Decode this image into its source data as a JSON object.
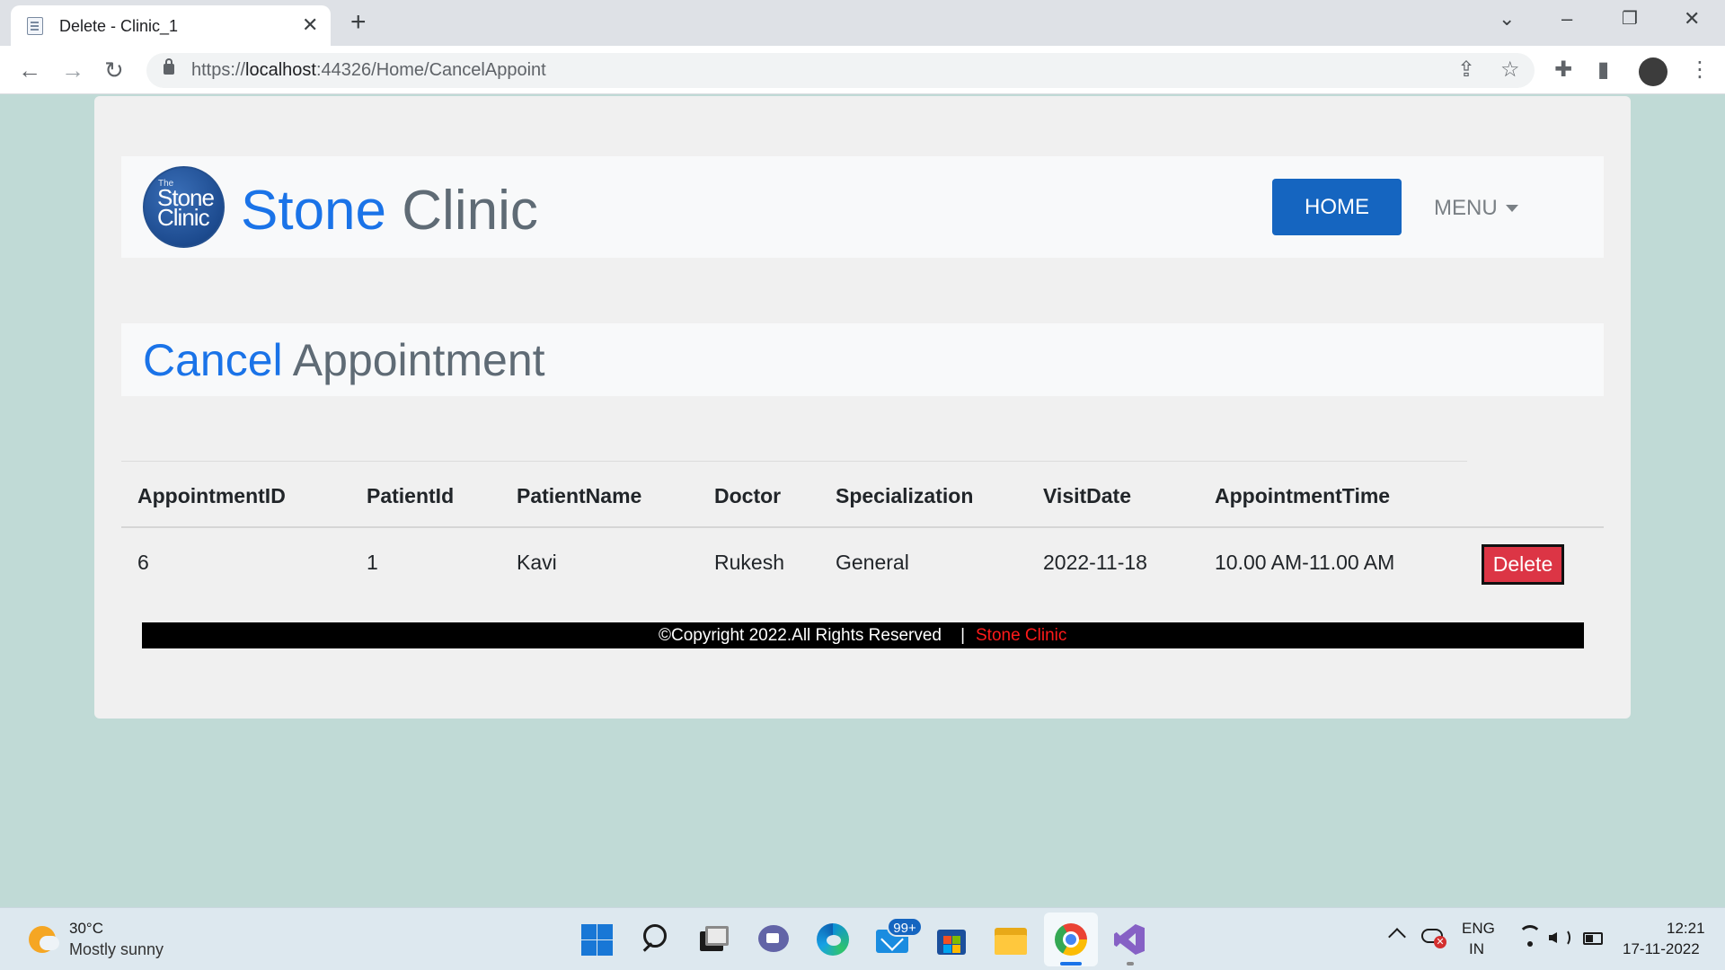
{
  "browser": {
    "tab_title": "Delete - Clinic_1",
    "url_prefix": "https://",
    "url_host": "localhost",
    "url_rest": ":44326/Home/CancelAppoint"
  },
  "logo": {
    "the": "The",
    "line1": "Stone",
    "line2": "Clinic"
  },
  "navbar": {
    "brand_first": "Stone",
    "brand_second": "Clinic",
    "home_label": "HOME",
    "menu_label": "MENU"
  },
  "heading": {
    "first": "Cancel",
    "second": "Appointment"
  },
  "table": {
    "headers": [
      "AppointmentID",
      "PatientId",
      "PatientName",
      "Doctor",
      "Specialization",
      "VisitDate",
      "AppointmentTime"
    ],
    "rows": [
      [
        "6",
        "1",
        "Kavi",
        "Rukesh",
        "General",
        "2022-11-18",
        "10.00 AM-11.00 AM"
      ]
    ],
    "delete_label": "Delete"
  },
  "footer": {
    "text": "©Copyright 2022.All Rights Reserved    |",
    "brand": "Stone Clinic"
  },
  "taskbar": {
    "weather_temp": "30°C",
    "weather_desc": "Mostly sunny",
    "mail_badge": "99+",
    "lang_line1": "ENG",
    "lang_line2": "IN",
    "time": "12:21",
    "date": "17-11-2022"
  },
  "colors": {
    "page_background": "#c0dad6",
    "brand_blue": "#1a73e8",
    "home_button": "#1565c0",
    "delete_button": "#dc3545",
    "footer_brand": "#ff1a1a"
  }
}
